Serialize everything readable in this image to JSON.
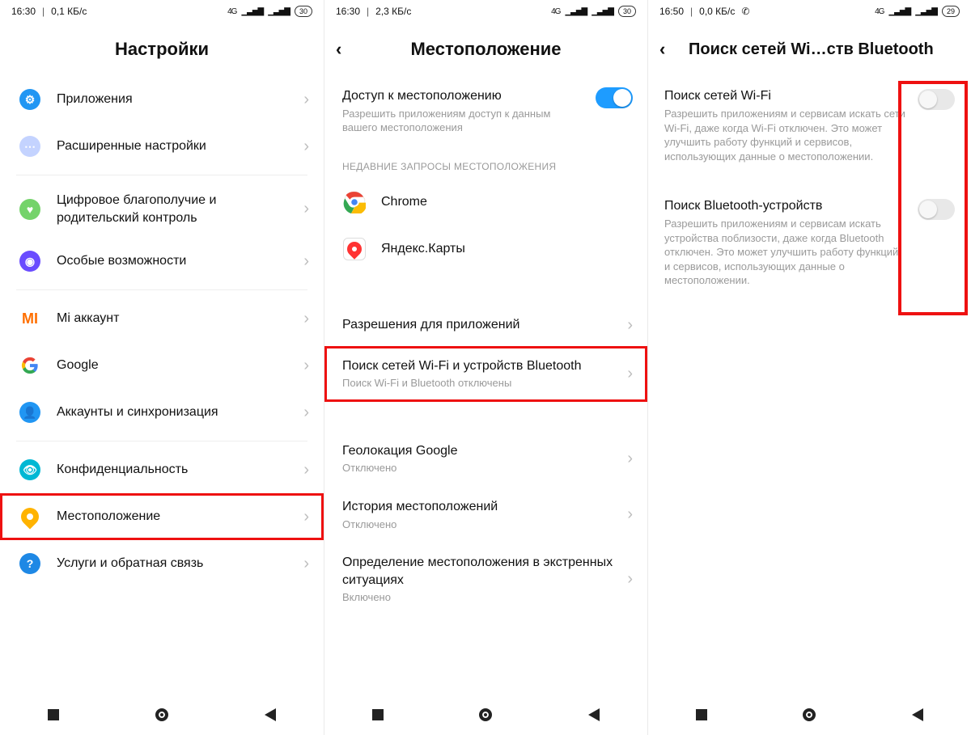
{
  "phone1": {
    "status": {
      "time": "16:30",
      "net": "0,1 КБ/с",
      "net_tag": "4G",
      "battery": "30"
    },
    "title": "Настройки",
    "items": [
      {
        "label": "Приложения",
        "icon_color": "#2196f3",
        "glyph": "⚙"
      },
      {
        "label": "Расширенные настройки",
        "icon_color": "#9bb7ff",
        "glyph": "⋯"
      }
    ],
    "items2": [
      {
        "label": "Цифровое благополучие и родительский контроль",
        "icon_color": "#7ed957",
        "glyph": "♥"
      },
      {
        "label": "Особые возможности",
        "icon_color": "#7a4cff",
        "glyph": "◯"
      }
    ],
    "items3": [
      {
        "label": "Mi аккаунт",
        "mi": true
      },
      {
        "label": "Google",
        "google": true
      },
      {
        "label": "Аккаунты и синхронизация",
        "icon_color": "#2196f3",
        "glyph": "👤"
      }
    ],
    "items4": [
      {
        "label": "Конфиденциальность",
        "icon_color": "#00b8d4",
        "glyph": "👁"
      },
      {
        "label": "Местоположение",
        "pin": true,
        "highlight": true
      },
      {
        "label": "Услуги и обратная связь",
        "icon_color": "#1e88e5",
        "glyph": "?"
      }
    ]
  },
  "phone2": {
    "status": {
      "time": "16:30",
      "net": "2,3 КБ/с",
      "net_tag": "4G",
      "battery": "30"
    },
    "title": "Местоположение",
    "access": {
      "title": "Доступ к местоположению",
      "sub": "Разрешить приложениям доступ к данным вашего местоположения"
    },
    "recent_label": "НЕДАВНИЕ ЗАПРОСЫ МЕСТОПОЛОЖЕНИЯ",
    "recent": [
      {
        "label": "Chrome"
      },
      {
        "label": "Яндекс.Карты"
      }
    ],
    "links": [
      {
        "title": "Разрешения для приложений"
      },
      {
        "title": "Поиск сетей Wi-Fi и устройств Bluetooth",
        "sub": "Поиск Wi-Fi и Bluetooth отключены",
        "highlight": true
      }
    ],
    "more": [
      {
        "title": "Геолокация Google",
        "sub": "Отключено"
      },
      {
        "title": "История местоположений",
        "sub": "Отключено"
      },
      {
        "title": "Определение местоположения в экстренных ситуациях",
        "sub": "Включено"
      }
    ]
  },
  "phone3": {
    "status": {
      "time": "16:50",
      "net": "0,0 КБ/с",
      "net_tag": "4G",
      "battery": "29",
      "whatsapp": true
    },
    "title": "Поиск сетей Wi…ств Bluetooth",
    "rows": [
      {
        "title": "Поиск сетей Wi-Fi",
        "sub": "Разрешить приложениям и сервисам искать сети Wi-Fi, даже когда Wi-Fi отключен. Это может улучшить работу функций и сервисов, использующих данные о местоположении."
      },
      {
        "title": "Поиск Bluetooth-устройств",
        "sub": "Разрешить приложениям и сервисам искать устройства поблизости, даже когда Bluetooth отключен. Это может улучшить работу функций и сервисов, использующих данные о местоположении."
      }
    ]
  }
}
